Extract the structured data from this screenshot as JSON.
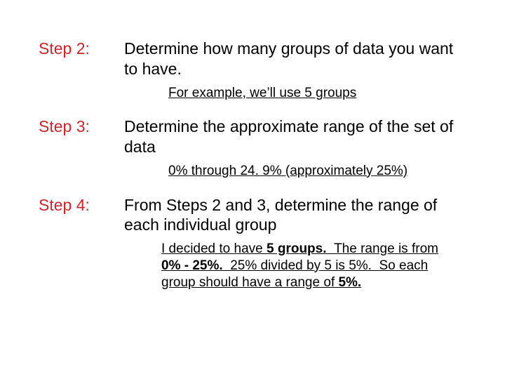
{
  "steps": [
    {
      "label": "Step 2:",
      "body": "Determine how many groups of data you want to have.",
      "note_html": "For example, we’ll use 5 groups"
    },
    {
      "label": "Step 3:",
      "body": "Determine the approximate range of the set of data",
      "note_html": "0% through 24. 9% (approximately 25%)"
    },
    {
      "label": "Step 4:",
      "body": "From Steps 2 and 3, determine the range of each individual group",
      "note_html": "I decided to have <span class=\"b\">5 groups.</span> &nbsp;The range is from <span class=\"b\">0% - 25%.</span> &nbsp;25% divided by 5 is 5%.&nbsp; So each group should have a range of <span class=\"b\">5%.</span>"
    }
  ]
}
